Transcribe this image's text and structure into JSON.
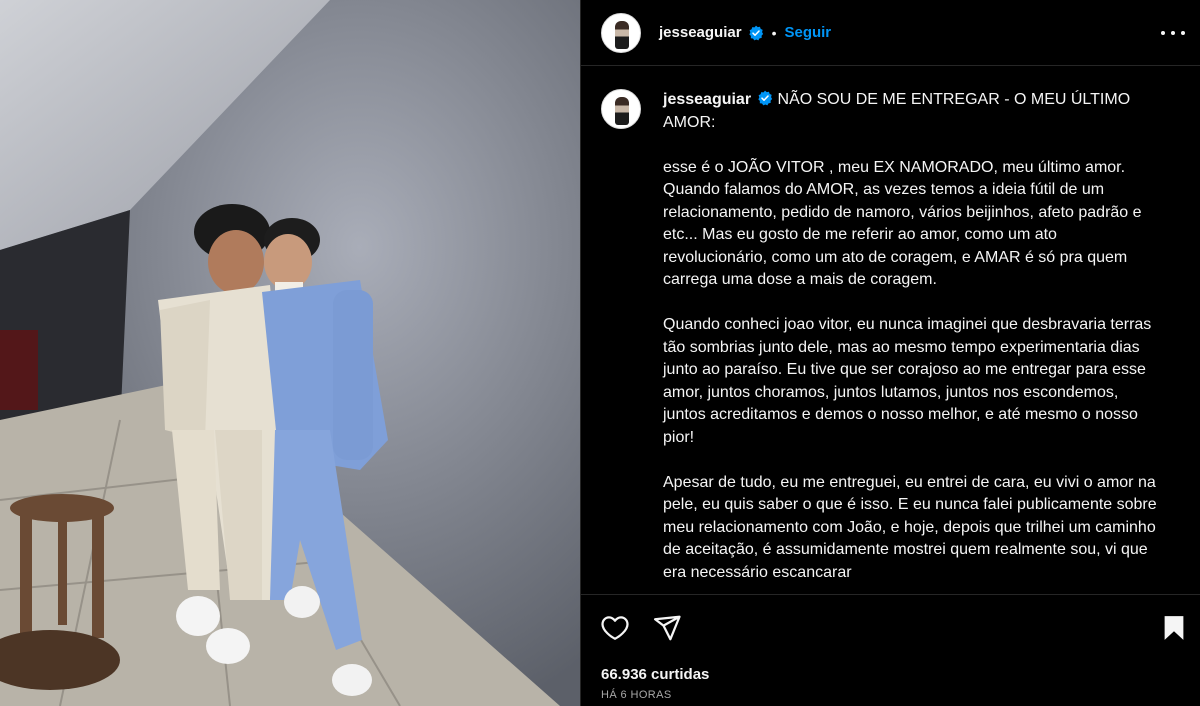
{
  "post": {
    "username": "jesseaguiar",
    "follow_label": "Seguir",
    "separator": "•",
    "caption_title": "NÃO SOU DE ME ENTREGAR - O MEU ÚLTIMO AMOR:",
    "caption_paragraphs": [
      "esse é o JOÃO VITOR , meu EX NAMORADO, meu último amor. Quando falamos do AMOR, as vezes temos a ideia fútil de um relacionamento, pedido de namoro, vários beijinhos, afeto padrão e etc... Mas eu gosto de me referir ao amor, como um ato revolucionário, como um ato de coragem, e AMAR é só pra quem carrega uma dose a mais de coragem.",
      "Quando conheci joao vitor, eu nunca imaginei que desbravaria terras tão sombrias junto dele, mas ao mesmo tempo experimentaria dias junto ao paraíso. Eu tive que ser corajoso ao me entregar para esse amor, juntos choramos, juntos lutamos, juntos nos escondemos, juntos acreditamos e demos o nosso melhor, e até mesmo o nosso pior!",
      "Apesar de tudo, eu me entreguei, eu entrei de cara, eu vivi o amor na pele, eu quis saber o que é isso. E eu nunca falei publicamente sobre meu relacionamento com João, e hoje, depois que trilhei um caminho de aceitação, é assumidamente mostrei quem realmente sou, vi que era necessário escancarar"
    ],
    "likes_label": "66.936 curtidas",
    "time_label": "HÁ 6 HORAS"
  },
  "icons": {
    "verified": "verified-badge-icon",
    "more": "more-options-icon",
    "like": "heart-icon",
    "share": "paper-plane-icon",
    "save": "bookmark-icon"
  },
  "colors": {
    "background": "#000000",
    "text": "#f5f5f5",
    "accent": "#0095f6",
    "muted": "#a8a8a8",
    "border": "#262626"
  }
}
